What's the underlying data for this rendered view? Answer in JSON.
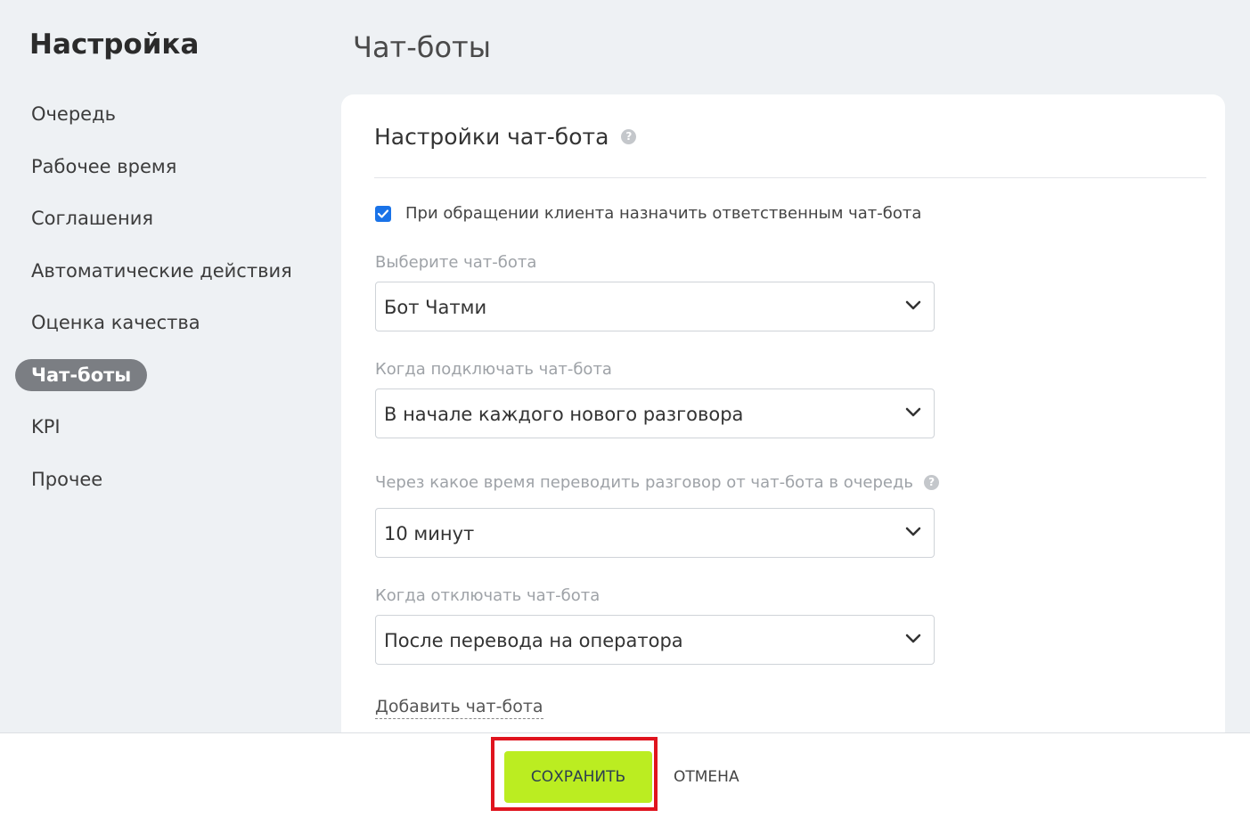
{
  "sidebar": {
    "title": "Настройка",
    "items": [
      {
        "label": "Очередь"
      },
      {
        "label": "Рабочее время"
      },
      {
        "label": "Соглашения"
      },
      {
        "label": "Автоматические действия"
      },
      {
        "label": "Оценка качества"
      },
      {
        "label": "Чат-боты",
        "active": true
      },
      {
        "label": "KPI"
      },
      {
        "label": "Прочее"
      }
    ]
  },
  "page": {
    "title": "Чат-боты"
  },
  "card": {
    "title": "Настройки чат-бота",
    "checkbox": {
      "checked": true,
      "label": "При обращении клиента назначить ответственным чат-бота"
    },
    "fields": [
      {
        "label": "Выберите чат-бота",
        "value": "Бот Чатми"
      },
      {
        "label": "Когда подключать чат-бота",
        "value": "В начале каждого нового разговора"
      },
      {
        "label": "Через какое время переводить разговор от чат-бота в очередь",
        "value": "10 минут",
        "has_help": true
      },
      {
        "label": "Когда отключать чат-бота",
        "value": "После перевода на оператора"
      }
    ],
    "add_link": "Добавить чат-бота"
  },
  "footer": {
    "save_label": "СОХРАНИТЬ",
    "cancel_label": "ОТМЕНА"
  },
  "colors": {
    "save_button": "#bbed21",
    "highlight": "#e0141e",
    "active_nav": "#7b7e83",
    "checkbox": "#1a73e8"
  }
}
